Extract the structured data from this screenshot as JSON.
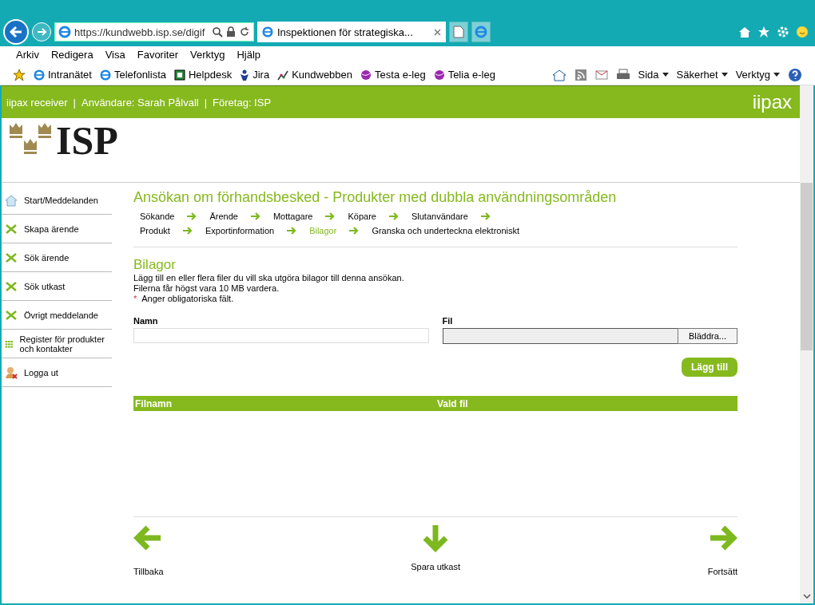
{
  "browser": {
    "address": "https://kundwebb.isp.se/digif",
    "tabs": [
      {
        "label": "Inspektionen för strategiska...",
        "selected": true
      }
    ],
    "menu": [
      "Arkiv",
      "Redigera",
      "Visa",
      "Favoriter",
      "Verktyg",
      "Hjälp"
    ],
    "favorites": [
      {
        "label": "Intranätet",
        "kind": "ie"
      },
      {
        "label": "Telefonlista",
        "kind": "ie"
      },
      {
        "label": "Helpdesk",
        "kind": "grid"
      },
      {
        "label": "Jira",
        "kind": "person"
      },
      {
        "label": "Kundwebben",
        "kind": "chart"
      },
      {
        "label": "Testa e-leg",
        "kind": "orb"
      },
      {
        "label": "Telia e-leg",
        "kind": "orb"
      }
    ],
    "commands": [
      "Sida",
      "Säkerhet",
      "Verktyg"
    ]
  },
  "header": {
    "segments": [
      "iipax receiver",
      "|",
      "Användare: Sarah Pålvall",
      "|",
      "Företag: ISP"
    ],
    "brand": "iipax"
  },
  "logo": {
    "text": "ISP"
  },
  "sidebar": {
    "items": [
      {
        "label": "Start/Meddelanden",
        "kind": "home"
      },
      {
        "label": "Skapa ärende",
        "kind": "cross"
      },
      {
        "label": "Sök ärende",
        "kind": "cross"
      },
      {
        "label": "Sök utkast",
        "kind": "cross"
      },
      {
        "label": "Övrigt meddelande",
        "kind": "cross"
      },
      {
        "label": "Register för produkter och kontakter",
        "kind": "grid"
      },
      {
        "label": "Logga ut",
        "kind": "logout"
      }
    ]
  },
  "page": {
    "title": "Ansökan om förhandsbesked - Produkter med dubbla användningsområden",
    "steps": [
      [
        {
          "label": "Sökande",
          "selected": false
        },
        {
          "label": "Ärende",
          "selected": false
        },
        {
          "label": "Mottagare",
          "selected": false
        },
        {
          "label": "Köpare",
          "selected": false
        },
        {
          "label": "Slutanvändare",
          "selected": false
        }
      ],
      [
        {
          "label": "Produkt",
          "selected": false
        },
        {
          "label": "Exportinformation",
          "selected": false
        },
        {
          "label": "Bilagor",
          "selected": true
        },
        {
          "label": "Granska och underteckna elektroniskt",
          "selected": false
        }
      ]
    ],
    "section": "Bilagor",
    "lines": [
      "Lägg till en eller flera filer du vill ska utgöra bilagor till denna ansökan.",
      "Filerna får högst vara 10 MB vardera."
    ],
    "required": {
      "mark": "*",
      "text": "Anger obligatoriska fält."
    },
    "form": {
      "name_label": "Namn",
      "file_label": "Fil",
      "browse": "Bläddra...",
      "add": "Lägg till"
    },
    "table": {
      "columns": [
        "Filnamn",
        "Vald fil"
      ]
    },
    "nav": [
      {
        "label": "Tillbaka",
        "kind": "back"
      },
      {
        "label": "Spara utkast",
        "kind": "save"
      },
      {
        "label": "Fortsätt",
        "kind": "next"
      }
    ]
  }
}
